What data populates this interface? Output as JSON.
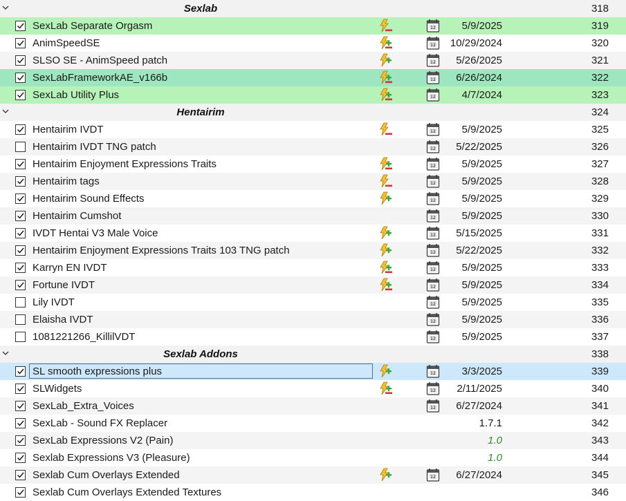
{
  "rows": [
    {
      "type": "separator",
      "title": "Sexlab",
      "priority": "318"
    },
    {
      "type": "mod",
      "checked": true,
      "name": "SexLab Separate Orgasm",
      "flag": "minus",
      "cal": true,
      "version": "5/9/2025",
      "priority": "319",
      "bg": "green"
    },
    {
      "type": "mod",
      "checked": true,
      "name": "AnimSpeedSE",
      "flag": "plusminus",
      "cal": true,
      "version": "10/29/2024",
      "priority": "320",
      "bg": "none"
    },
    {
      "type": "mod",
      "checked": true,
      "name": "SLSO SE - AnimSpeed patch",
      "flag": "plus",
      "cal": true,
      "version": "5/26/2025",
      "priority": "321",
      "bg": "alt"
    },
    {
      "type": "mod",
      "checked": true,
      "name": "SexLabFrameworkAE_v166b",
      "flag": "plusminus",
      "cal": true,
      "version": "6/26/2024",
      "priority": "322",
      "bg": "teal"
    },
    {
      "type": "mod",
      "checked": true,
      "name": "SexLab Utility Plus",
      "flag": "plusminus",
      "cal": true,
      "version": "4/7/2024",
      "priority": "323",
      "bg": "green"
    },
    {
      "type": "separator",
      "title": "Hentairim",
      "priority": "324"
    },
    {
      "type": "mod",
      "checked": true,
      "name": "Hentairim IVDT",
      "flag": "minus",
      "cal": true,
      "version": "5/9/2025",
      "priority": "325",
      "bg": "none"
    },
    {
      "type": "mod",
      "checked": false,
      "name": "Hentairim IVDT TNG patch",
      "flag": "none",
      "cal": true,
      "version": "5/22/2025",
      "priority": "326",
      "bg": "alt"
    },
    {
      "type": "mod",
      "checked": true,
      "name": "Hentairim Enjoyment Expressions Traits",
      "flag": "plusminus",
      "cal": true,
      "version": "5/9/2025",
      "priority": "327",
      "bg": "none"
    },
    {
      "type": "mod",
      "checked": true,
      "name": "Hentairim tags",
      "flag": "minus",
      "cal": true,
      "version": "5/9/2025",
      "priority": "328",
      "bg": "alt"
    },
    {
      "type": "mod",
      "checked": true,
      "name": "Hentairim Sound Effects",
      "flag": "plus",
      "cal": true,
      "version": "5/9/2025",
      "priority": "329",
      "bg": "none"
    },
    {
      "type": "mod",
      "checked": true,
      "name": "Hentairim Cumshot",
      "flag": "none",
      "cal": true,
      "version": "5/9/2025",
      "priority": "330",
      "bg": "alt"
    },
    {
      "type": "mod",
      "checked": true,
      "name": "IVDT Hentai V3 Male Voice",
      "flag": "plus",
      "cal": true,
      "version": "5/15/2025",
      "priority": "331",
      "bg": "none"
    },
    {
      "type": "mod",
      "checked": true,
      "name": "Hentairim Enjoyment Expressions Traits 103 TNG patch",
      "flag": "plus",
      "cal": true,
      "version": "5/22/2025",
      "priority": "332",
      "bg": "alt"
    },
    {
      "type": "mod",
      "checked": true,
      "name": "Karryn EN IVDT",
      "flag": "plusminus",
      "cal": true,
      "version": "5/9/2025",
      "priority": "333",
      "bg": "none"
    },
    {
      "type": "mod",
      "checked": true,
      "name": "Fortune IVDT",
      "flag": "plusminus",
      "cal": true,
      "version": "5/9/2025",
      "priority": "334",
      "bg": "alt"
    },
    {
      "type": "mod",
      "checked": false,
      "name": "Lily IVDT",
      "flag": "none",
      "cal": true,
      "version": "5/9/2025",
      "priority": "335",
      "bg": "none"
    },
    {
      "type": "mod",
      "checked": false,
      "name": "Elaisha IVDT",
      "flag": "none",
      "cal": true,
      "version": "5/9/2025",
      "priority": "336",
      "bg": "alt"
    },
    {
      "type": "mod",
      "checked": false,
      "name": "1081221266_KillilVDT",
      "flag": "none",
      "cal": true,
      "version": "5/9/2025",
      "priority": "337",
      "bg": "none"
    },
    {
      "type": "separator",
      "title": "Sexlab Addons",
      "priority": "338"
    },
    {
      "type": "mod",
      "checked": true,
      "name": "SL smooth expressions plus",
      "flag": "plus",
      "cal": true,
      "version": "3/3/2025",
      "priority": "339",
      "bg": "sel",
      "focus": true
    },
    {
      "type": "mod",
      "checked": true,
      "name": "SLWidgets",
      "flag": "plusminus",
      "cal": true,
      "version": "2/11/2025",
      "priority": "340",
      "bg": "none"
    },
    {
      "type": "mod",
      "checked": true,
      "name": "SexLab_Extra_Voices",
      "flag": "none",
      "cal": true,
      "version": "6/27/2024",
      "priority": "341",
      "bg": "alt"
    },
    {
      "type": "mod",
      "checked": true,
      "name": "SexLab - Sound FX Replacer",
      "flag": "none",
      "cal": false,
      "version": "1.7.1",
      "priority": "342",
      "bg": "none"
    },
    {
      "type": "mod",
      "checked": true,
      "name": "SexLab Expressions V2 (Pain)",
      "flag": "none",
      "cal": false,
      "version": "1.0",
      "versionStyle": "green",
      "priority": "343",
      "bg": "alt"
    },
    {
      "type": "mod",
      "checked": true,
      "name": "Sexlab Expressions V3 (Pleasure)",
      "flag": "none",
      "cal": false,
      "version": "1.0",
      "versionStyle": "green",
      "priority": "344",
      "bg": "none"
    },
    {
      "type": "mod",
      "checked": true,
      "name": "Sexlab Cum Overlays Extended",
      "flag": "plus",
      "cal": true,
      "version": "6/27/2024",
      "priority": "345",
      "bg": "alt"
    },
    {
      "type": "mod",
      "checked": true,
      "name": "Sexlab Cum Overlays Extended Textures",
      "flag": "none",
      "cal": false,
      "version": "",
      "priority": "346",
      "bg": "none"
    }
  ]
}
